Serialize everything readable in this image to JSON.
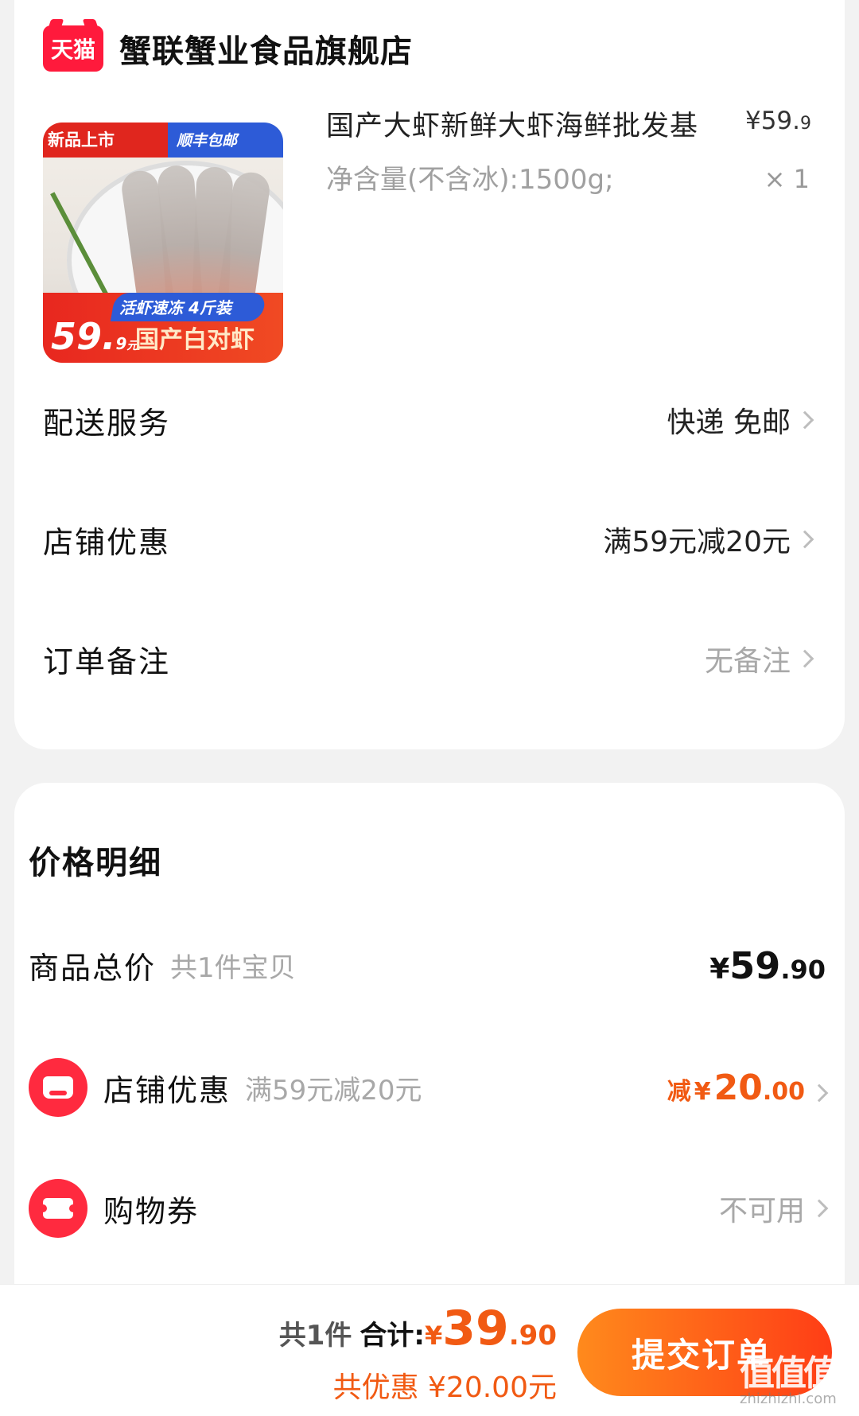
{
  "shop": {
    "logo_text": "天猫",
    "name": "蟹联蟹业食品旗舰店"
  },
  "product": {
    "image": {
      "tag_new": "新品上市",
      "tag_shipping": "顺丰包邮",
      "band_text": "活虾速冻 4斤装",
      "price_int": "59.",
      "price_dec": "9",
      "price_unit": "元",
      "name": "国产白对虾"
    },
    "title": "国产大虾新鲜大虾海鲜批发基",
    "price_prefix": "¥",
    "price_int": "59.",
    "price_dec": "9",
    "spec": "净含量(不含冰):1500g;",
    "quantity": "× 1"
  },
  "order_rows": [
    {
      "label": "配送服务",
      "value": "快递 免邮"
    },
    {
      "label": "店铺优惠",
      "value": "满59元减20元"
    },
    {
      "label": "订单备注",
      "value": "无备注"
    }
  ],
  "price_detail": {
    "title": "价格明细",
    "total": {
      "label": "商品总价",
      "sub": "共1件宝贝",
      "currency": "¥",
      "int": "59",
      "dec": ".90"
    },
    "shop_discount": {
      "label": "店铺优惠",
      "sub": "满59元减20元",
      "prefix": "减",
      "currency": "¥",
      "int": "20",
      "dec": ".00"
    },
    "coupon": {
      "label": "购物券",
      "value": "不可用"
    }
  },
  "bottom_bar": {
    "count": "共1件",
    "total_label": "合计:",
    "currency": "¥",
    "total_int": "39",
    "total_dec": ".90",
    "discount_text": "共优惠 ¥20.00元",
    "submit_label": "提交订单"
  },
  "watermark": {
    "text": "值值值",
    "sub": "zhizhizhi.com"
  },
  "colors": {
    "accent": "#f15a13",
    "tmall_red": "#ff1a3c",
    "submit_gradient_start": "#ff8a1c",
    "submit_gradient_end": "#ff3d16",
    "muted_text": "#a8a8a8"
  },
  "icons": [
    "tmall-logo",
    "chevron-right-icon",
    "store-icon",
    "ticket-icon"
  ]
}
